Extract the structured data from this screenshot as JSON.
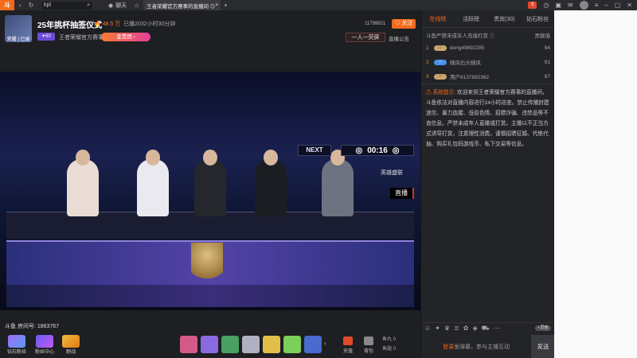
{
  "topbar": {
    "logo_text": "斗",
    "address_text": "kpl",
    "tab1_label": "聊天",
    "active_tab_title": "王者荣耀官方赛事的直播间 ⊙",
    "badge": "5"
  },
  "room": {
    "title": "25年挑杯抽签仪式",
    "hot": "🔥 48.5 万",
    "duration": "已播2032小时30分钟",
    "level": "✦60",
    "category": "王者荣耀官方赛事",
    "vip_button": "金贵团 ›",
    "fans_count": "11799921",
    "follow_label": "♡ 关注",
    "banner_text": "一人一荧屏",
    "notice": "直播公告",
    "avatar_caption": "荣耀 | 已录"
  },
  "video": {
    "next_label": "NEXT",
    "timer": "00:16",
    "hero_tag": "英雄盛联",
    "live_tag": "直播"
  },
  "room_number": "斗鱼 房间号: 1863767",
  "bottom": {
    "items": [
      {
        "label": "钻石粉丝"
      },
      {
        "label": "粉丝中心"
      },
      {
        "label": "野战"
      }
    ],
    "recharge": "充值",
    "bag": "背包",
    "fish_balls": "鱼丸  0",
    "fish_wings": "鱼翅  0"
  },
  "right": {
    "tabs": [
      "在线榜",
      "活跃榜",
      "贵宾(30)",
      "钻石粉丝"
    ],
    "rank_header_left": "斗鱼严禁未成年人充值打赏 ⓘ",
    "rank_header_right": "贡献值",
    "rank_rows": [
      {
        "no": "1",
        "name": "dong49892285",
        "value": "94"
      },
      {
        "no": "2",
        "name": "随风石头随风",
        "value": "91"
      },
      {
        "no": "3",
        "name": "用户8137892362",
        "value": "87"
      }
    ],
    "system_label": "⚠ 系统提示:",
    "system_text": "欢迎来到王者荣耀官方赛事的直播间，斗鱼依法对直播内容进行24小时巡查。禁止传播封建迷信、暴力血腥、低俗色情、招嫖诈骗、违禁品等不良信息。严禁未成年人直播或打赏。主播以不正当方式诱导打赏，注意理性消费。谨慎招聘征婚、代练代抽、购买礼包码游戏币、私下交易等信息。",
    "toggle": "• 屏蔽",
    "login_text": "登录",
    "input_text": "发弹幕，参与主播互动",
    "send_label": "发送"
  }
}
